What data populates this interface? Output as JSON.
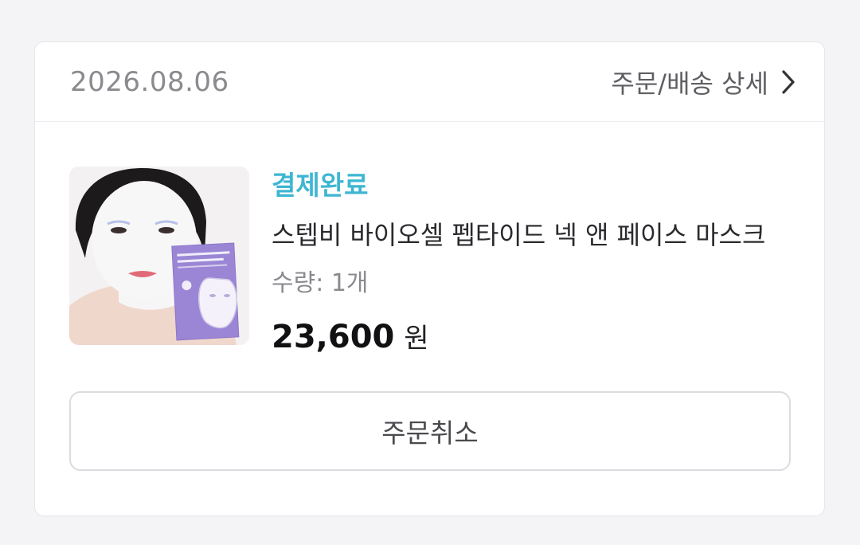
{
  "order": {
    "date": "2026.08.06",
    "detail_link_label": "주문/배송 상세",
    "detail_link_icon": "chevron-right-icon"
  },
  "product": {
    "status": "결제완료",
    "status_color": "#3eb6d2",
    "name": "스텝비 바이오셀 펩타이드 넥 앤 페이스 마스크",
    "quantity": "수량: 1개",
    "price": "23,600",
    "currency": "원",
    "image_package_text": "STEP B BioCell Peptide Neck & Face Mask"
  },
  "actions": {
    "cancel_label": "주문취소"
  }
}
